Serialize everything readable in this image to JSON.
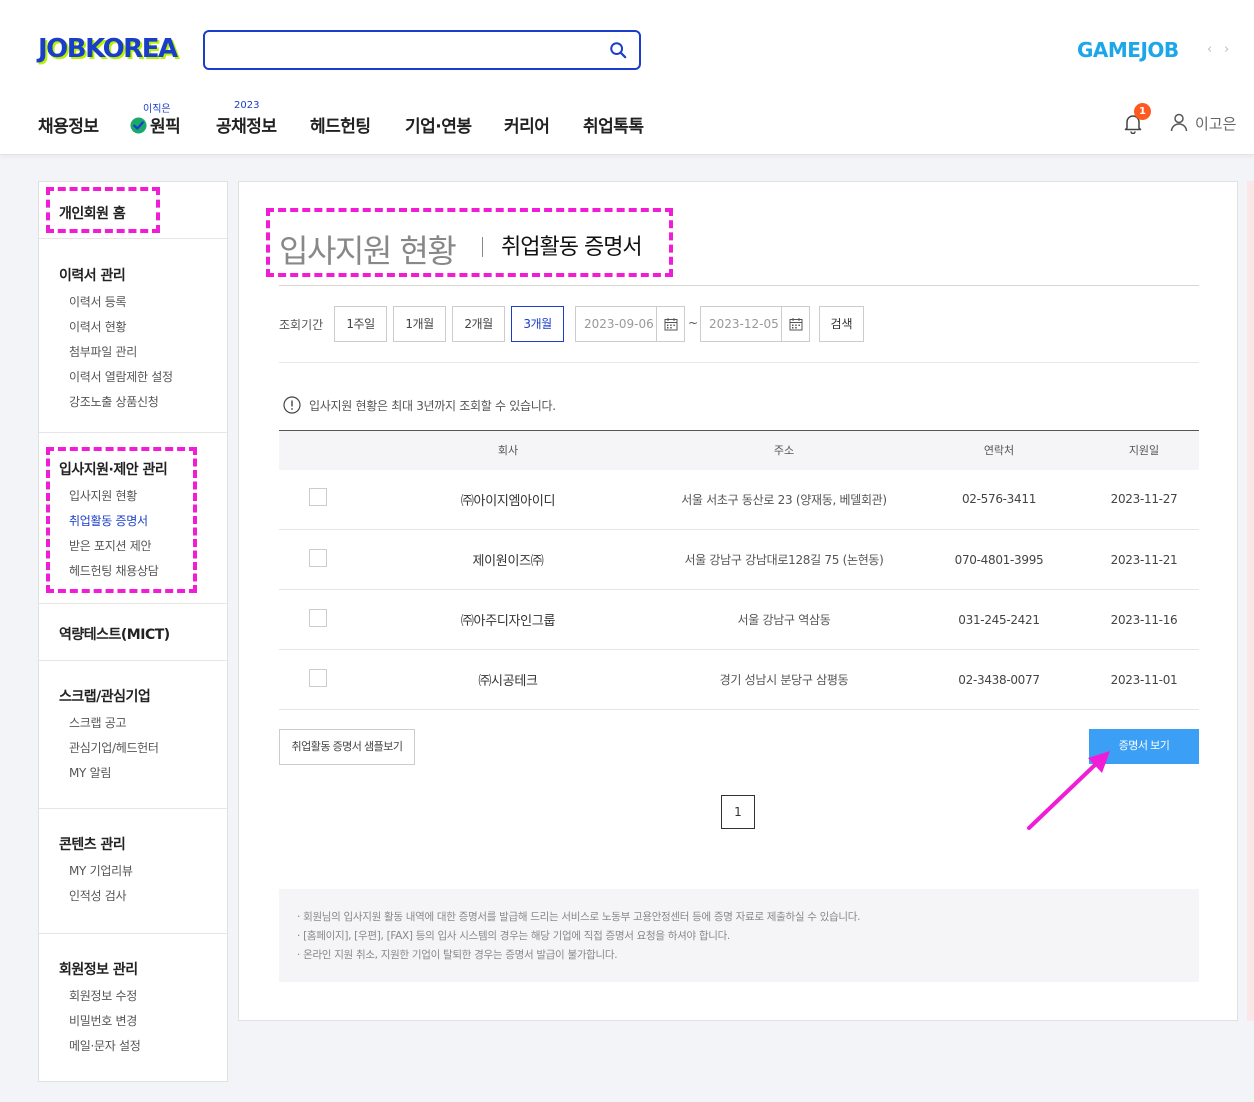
{
  "header": {
    "logo": "JOBKOREA",
    "search_placeholder": "",
    "gamejob": "GAMEJOB",
    "nav": [
      {
        "label": "채용정보",
        "sup": ""
      },
      {
        "label": "원픽",
        "sup": "이직은"
      },
      {
        "label": "공채정보",
        "sup": "2023"
      },
      {
        "label": "헤드헌팅",
        "sup": ""
      },
      {
        "label": "기업·연봉",
        "sup": ""
      },
      {
        "label": "커리어",
        "sup": ""
      },
      {
        "label": "취업톡톡",
        "sup": ""
      }
    ],
    "notification_count": "1",
    "user_name": "이고은"
  },
  "sidebar": {
    "home": "개인회원 홈",
    "sections": [
      {
        "title": "이력서 관리",
        "items": [
          "이력서 등록",
          "이력서 현황",
          "첨부파일 관리",
          "이력서 열람제한 설정",
          "강조노출 상품신청"
        ]
      },
      {
        "title": "입사지원·제안 관리",
        "items": [
          "입사지원 현황",
          "취업활동 증명서",
          "받은 포지션 제안",
          "헤드헌팅 채용상담"
        ]
      },
      {
        "title": "역량테스트(MICT)",
        "items": []
      },
      {
        "title": "스크랩/관심기업",
        "items": [
          "스크랩 공고",
          "관심기업/헤드헌터",
          "MY 알림"
        ]
      },
      {
        "title": "콘텐츠 관리",
        "items": [
          "MY 기업리뷰",
          "인적성 검사"
        ]
      },
      {
        "title": "회원정보 관리",
        "items": [
          "회원정보 수정",
          "비밀번호 변경",
          "메일·문자 설정"
        ]
      }
    ],
    "active_item": "취업활동 증명서"
  },
  "main": {
    "title": "입사지원 현황",
    "subtitle": "취업활동 증명서",
    "filter": {
      "label": "조회기간",
      "periods": [
        "1주일",
        "1개월",
        "2개월",
        "3개월"
      ],
      "selected": "3개월",
      "start_date": "2023-09-06",
      "end_date": "2023-12-05",
      "tilde": "~",
      "search": "검색"
    },
    "notice": "입사지원 현황은 최대 3년까지 조회할 수 있습니다.",
    "table": {
      "headers": [
        "회사",
        "주소",
        "연락처",
        "지원일"
      ],
      "rows": [
        {
          "company": "㈜아이지엠아이디",
          "address": "서울 서초구 동산로 23 (양재동, 베델회관)",
          "phone": "02-576-3411",
          "date": "2023-11-27"
        },
        {
          "company": "제이원이즈㈜",
          "address": "서울 강남구 강남대로128길 75 (논현동)",
          "phone": "070-4801-3995",
          "date": "2023-11-21"
        },
        {
          "company": "㈜아주디자인그룹",
          "address": "서울 강남구 역삼동",
          "phone": "031-245-2421",
          "date": "2023-11-16"
        },
        {
          "company": "㈜시공테크",
          "address": "경기 성남시 분당구 삼평동",
          "phone": "02-3438-0077",
          "date": "2023-11-01"
        }
      ]
    },
    "sample_button": "취업활동 증명서 샘플보기",
    "view_button": "증명서 보기",
    "page": "1",
    "guide": [
      "회원님의 입사지원 활동 내역에 대한 증명서를 발급해 드리는 서비스로 노동부 고용안정센터 등에 증명 자료로 제출하실 수 있습니다.",
      "[홈페이지], [우편], [FAX] 등의 입사 시스템의 경우는 해당 기업에 직접 증명서 요청을 하셔야 합니다.",
      "온라인 지원 취소, 지원한 기업이 탈퇴한 경우는 증명서 발급이 불가합니다."
    ]
  },
  "colors": {
    "brand": "#1a3ec9",
    "accent_button": "#3a9ff5",
    "annotation": "#f11cd6",
    "gamejob": "#1da6e8",
    "badge": "#ff5a1f"
  }
}
